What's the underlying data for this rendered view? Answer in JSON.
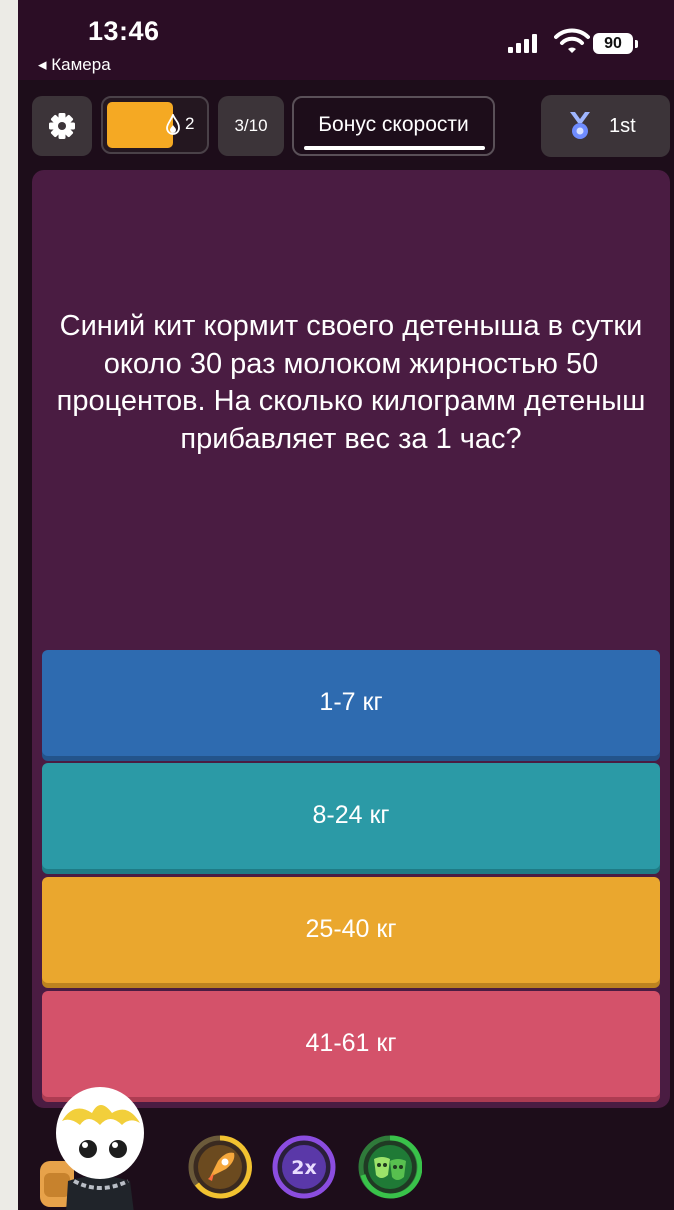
{
  "status_bar": {
    "time": "13:46",
    "back_label": "◂ Камера",
    "battery": "90"
  },
  "top_bar": {
    "streak_count": "2",
    "question_counter": "3/10",
    "bonus_label": "Бонус скорости",
    "rank_label": "1st"
  },
  "question": {
    "text": "Синий кит кормит своего детеныша в сутки около 30 раз молоком жирностью 50 процентов. На сколько килограмм детеныш прибавляет вес за 1 час?"
  },
  "options": [
    {
      "label": "1-7 кг",
      "color": "#2e6bb0"
    },
    {
      "label": "8-24 кг",
      "color": "#2b9aa6"
    },
    {
      "label": "25-40 кг",
      "color": "#eaa72e"
    },
    {
      "label": "41-61 кг",
      "color": "#d4526a"
    }
  ],
  "powerups": [
    {
      "icon": "rocket-icon",
      "color": "#f2c230"
    },
    {
      "icon": "double-points-icon",
      "label": "2x",
      "color": "#8b4de0"
    },
    {
      "icon": "masks-icon",
      "color": "#39c24a"
    }
  ]
}
